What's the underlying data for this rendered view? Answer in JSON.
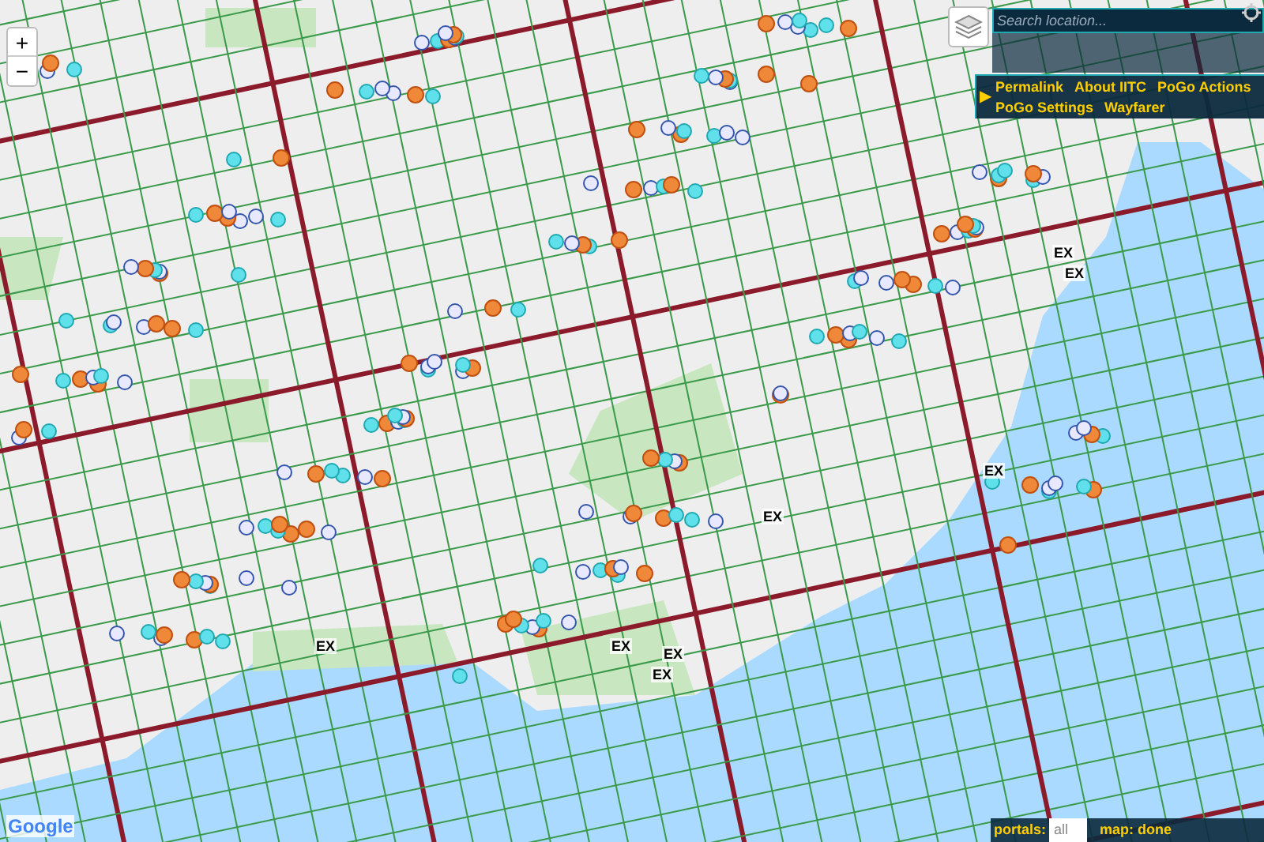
{
  "zoom_controls": [
    "+",
    "−"
  ],
  "search": {
    "placeholder": "Search location..."
  },
  "toolbox_links": [
    "Permalink",
    "About IITC",
    "PoGo Actions",
    "PoGo Settings",
    "Wayfarer"
  ],
  "toolbox_toggle": "▶",
  "ex_badges": [
    "EX",
    "EX",
    "EX",
    "EX",
    "EX",
    "EX",
    "EX",
    "EX"
  ],
  "map_attribution": "Google",
  "status_bar": {
    "portals_label": "portals:",
    "portals_value": "all",
    "map_status": "map: done"
  }
}
